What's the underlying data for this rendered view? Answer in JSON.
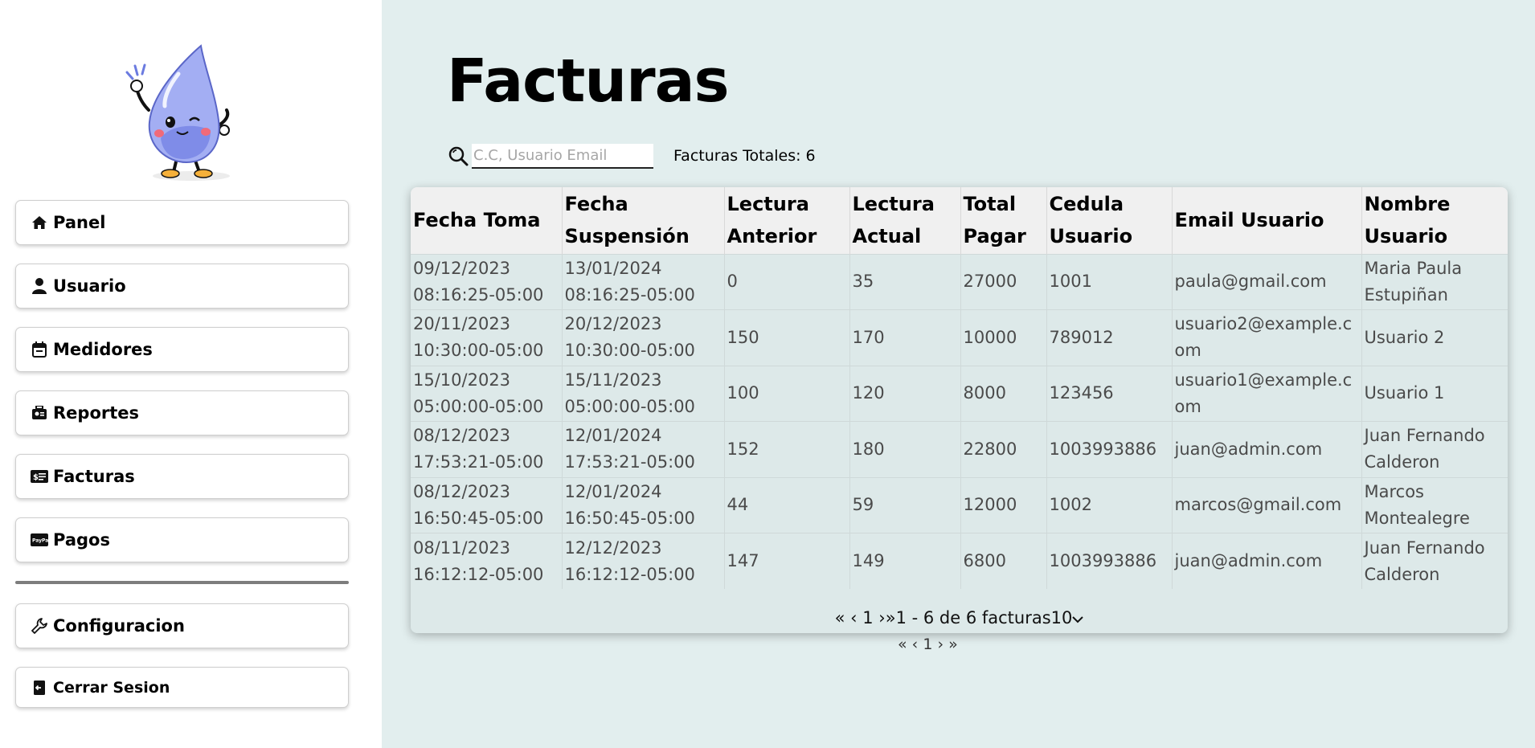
{
  "sidebar": {
    "items": [
      {
        "label": "Panel",
        "icon": "home-icon"
      },
      {
        "label": "Usuario",
        "icon": "user-icon"
      },
      {
        "label": "Medidores",
        "icon": "calendar-icon"
      },
      {
        "label": "Reportes",
        "icon": "report-icon"
      },
      {
        "label": "Facturas",
        "icon": "invoice-icon"
      },
      {
        "label": "Pagos",
        "icon": "paypal-icon"
      }
    ],
    "settings": {
      "label": "Configuracion",
      "icon": "wrench-icon"
    },
    "logout": {
      "label": "Cerrar Sesion",
      "icon": "logout-icon"
    }
  },
  "main": {
    "title": "Facturas",
    "search": {
      "placeholder": "C.C, Usuario Email",
      "value": ""
    },
    "total_label": "Facturas Totales: 6",
    "table": {
      "headers": [
        "Fecha Toma",
        "Fecha Suspensión",
        "Lectura Anterior",
        "Lectura Actual",
        "Total Pagar",
        "Cedula Usuario",
        "Email Usuario",
        "Nombre Usuario"
      ],
      "rows": [
        [
          "09/12/2023 08:16:25-05:00",
          "13/01/2024 08:16:25-05:00",
          "0",
          "35",
          "27000",
          "1001",
          "paula@gmail.com",
          "Maria Paula Estupiñan"
        ],
        [
          "20/11/2023 10:30:00-05:00",
          "20/12/2023 10:30:00-05:00",
          "150",
          "170",
          "10000",
          "789012",
          "usuario2@example.com",
          "Usuario 2"
        ],
        [
          "15/10/2023 05:00:00-05:00",
          "15/11/2023 05:00:00-05:00",
          "100",
          "120",
          "8000",
          "123456",
          "usuario1@example.com",
          "Usuario 1"
        ],
        [
          "08/12/2023 17:53:21-05:00",
          "12/01/2024 17:53:21-05:00",
          "152",
          "180",
          "22800",
          "1003993886",
          "juan@admin.com",
          "Juan Fernando Calderon"
        ],
        [
          "08/12/2023 16:50:45-05:00",
          "12/01/2024 16:50:45-05:00",
          "44",
          "59",
          "12000",
          "1002",
          "marcos@gmail.com",
          "Marcos Montealegre"
        ],
        [
          "08/11/2023 16:12:12-05:00",
          "12/12/2023 16:12:12-05:00",
          "147",
          "149",
          "6800",
          "1003993886",
          "juan@admin.com",
          "Juan Fernando Calderon"
        ]
      ]
    },
    "pagination": {
      "first": "«",
      "prev": "‹",
      "page": "1",
      "next": "›",
      "last": "»",
      "range_text": "1 - 6 de 6 facturas",
      "page_size": "10"
    },
    "pagination_secondary": {
      "first": "«",
      "prev": "‹",
      "page": "1",
      "next": "›",
      "last": "»"
    }
  },
  "colors": {
    "background": "#e2eeee",
    "sidebar": "#ffffff",
    "table_header": "#f0f0f0",
    "table_body": "#dde9e9",
    "mascot_body": "#9aa6f2",
    "mascot_cheek": "#f06a7a",
    "mascot_shoes": "#f5b03a"
  }
}
